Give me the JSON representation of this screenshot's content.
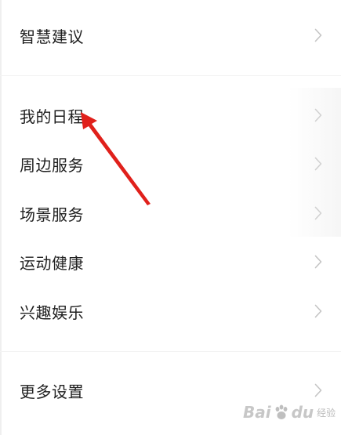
{
  "menu": {
    "items": [
      {
        "label": "智慧建议"
      },
      {
        "label": "我的日程"
      },
      {
        "label": "周边服务"
      },
      {
        "label": "场景服务"
      },
      {
        "label": "运动健康"
      },
      {
        "label": "兴趣娱乐"
      },
      {
        "label": "更多设置"
      }
    ]
  },
  "icons": {
    "chevron": "chevron-right-icon",
    "annotation": "red-arrow-icon"
  },
  "colors": {
    "text": "#1f1f1f",
    "chevron": "#c4c4c4",
    "annotation_arrow": "#e0201b",
    "background": "#ffffff"
  },
  "watermark": {
    "text_a": "Bai",
    "text_b": "du",
    "sub": "经验"
  }
}
